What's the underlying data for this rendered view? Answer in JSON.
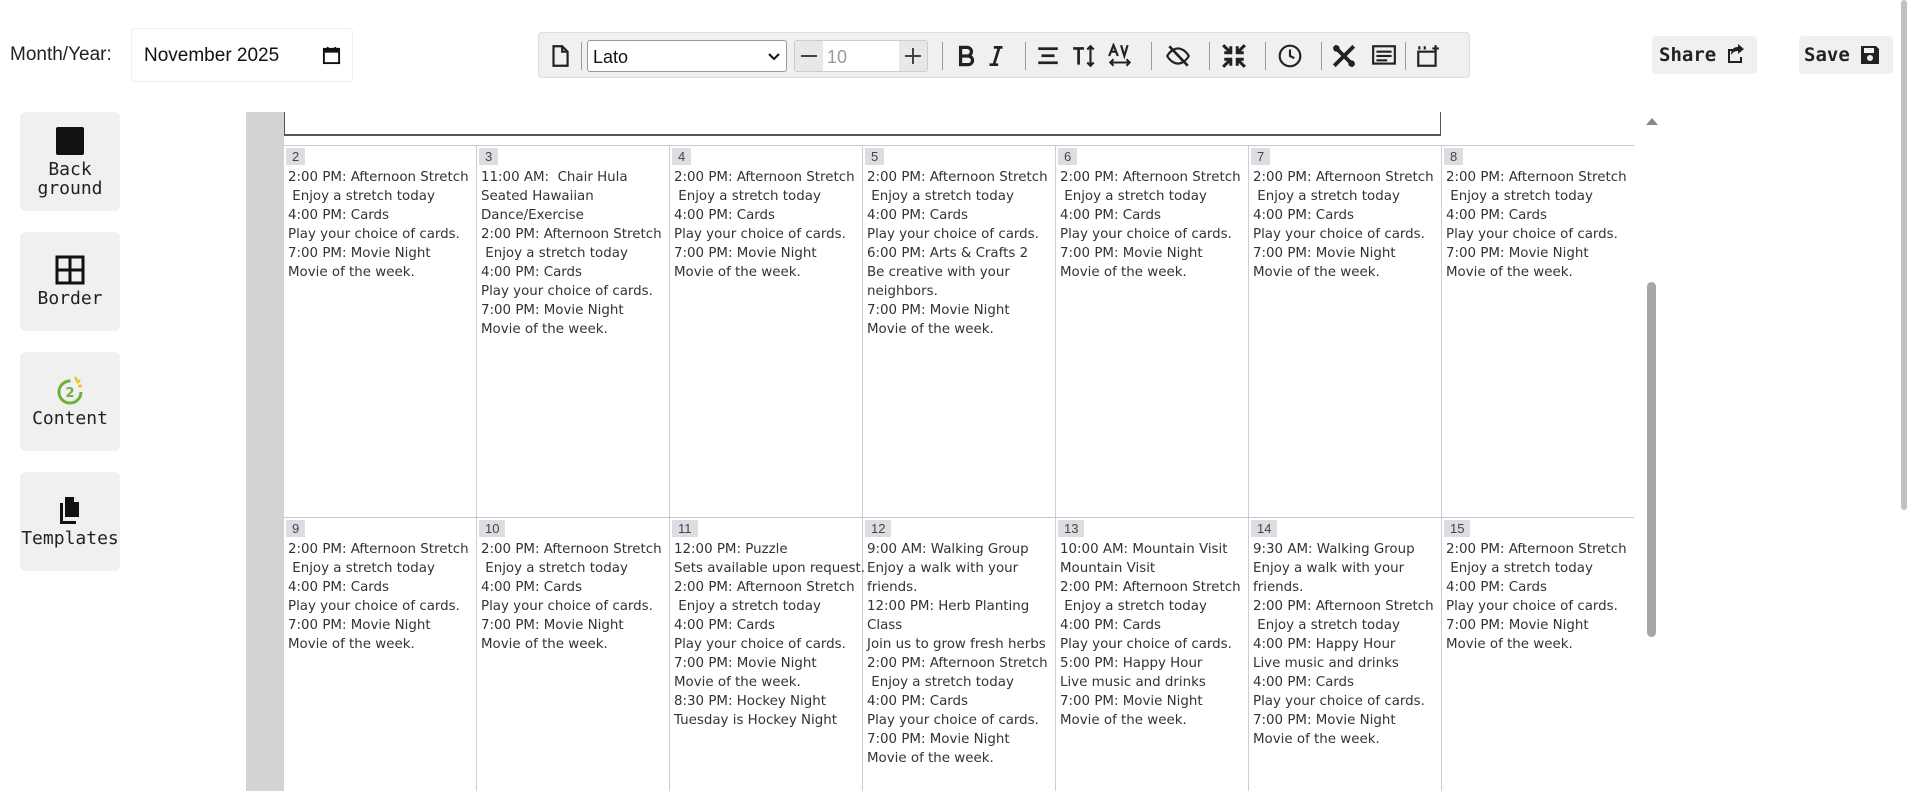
{
  "header": {
    "month_year_label": "Month/Year:",
    "month_year_value": "November 2025"
  },
  "toolbar": {
    "font_family": "Lato",
    "font_size_placeholder": "10"
  },
  "actions": {
    "share_label": "Share",
    "save_label": "Save"
  },
  "sidebar": {
    "background_label": "Back\nground",
    "border_label": "Border",
    "content_label": "Content",
    "content_badge": "2",
    "templates_label": "Templates"
  },
  "calendar": {
    "weeks": [
      {
        "days": [
          {
            "day": "2",
            "events": [
              "2:00 PM: Afternoon Stretch",
              " Enjoy a stretch today",
              "4:00 PM: Cards",
              "Play your choice of cards.",
              "7:00 PM: Movie Night",
              "Movie of the week."
            ]
          },
          {
            "day": "3",
            "events": [
              "11:00 AM:  Chair Hula",
              "Seated Hawaiian",
              "Dance/Exercise",
              "2:00 PM: Afternoon Stretch",
              " Enjoy a stretch today",
              "4:00 PM: Cards",
              "Play your choice of cards.",
              "7:00 PM: Movie Night",
              "Movie of the week."
            ]
          },
          {
            "day": "4",
            "events": [
              "2:00 PM: Afternoon Stretch",
              " Enjoy a stretch today",
              "4:00 PM: Cards",
              "Play your choice of cards.",
              "7:00 PM: Movie Night",
              "Movie of the week."
            ]
          },
          {
            "day": "5",
            "events": [
              "2:00 PM: Afternoon Stretch",
              " Enjoy a stretch today",
              "4:00 PM: Cards",
              "Play your choice of cards.",
              "6:00 PM: Arts & Crafts 2",
              "Be creative with your",
              "neighbors.",
              "7:00 PM: Movie Night",
              "Movie of the week."
            ]
          },
          {
            "day": "6",
            "events": [
              "2:00 PM: Afternoon Stretch",
              " Enjoy a stretch today",
              "4:00 PM: Cards",
              "Play your choice of cards.",
              "7:00 PM: Movie Night",
              "Movie of the week."
            ]
          },
          {
            "day": "7",
            "events": [
              "2:00 PM: Afternoon Stretch",
              " Enjoy a stretch today",
              "4:00 PM: Cards",
              "Play your choice of cards.",
              "7:00 PM: Movie Night",
              "Movie of the week."
            ]
          },
          {
            "day": "8",
            "events": [
              "2:00 PM: Afternoon Stretch",
              " Enjoy a stretch today",
              "4:00 PM: Cards",
              "Play your choice of cards.",
              "7:00 PM: Movie Night",
              "Movie of the week."
            ]
          }
        ]
      },
      {
        "days": [
          {
            "day": "9",
            "events": [
              "2:00 PM: Afternoon Stretch",
              " Enjoy a stretch today",
              "4:00 PM: Cards",
              "Play your choice of cards.",
              "7:00 PM: Movie Night",
              "Movie of the week."
            ]
          },
          {
            "day": "10",
            "events": [
              "2:00 PM: Afternoon Stretch",
              " Enjoy a stretch today",
              "4:00 PM: Cards",
              "Play your choice of cards.",
              "7:00 PM: Movie Night",
              "Movie of the week."
            ]
          },
          {
            "day": "11",
            "events": [
              "12:00 PM: Puzzle",
              "Sets available upon request.",
              "2:00 PM: Afternoon Stretch",
              " Enjoy a stretch today",
              "4:00 PM: Cards",
              "Play your choice of cards.",
              "7:00 PM: Movie Night",
              "Movie of the week.",
              "8:30 PM: Hockey Night",
              "Tuesday is Hockey Night"
            ]
          },
          {
            "day": "12",
            "events": [
              "9:00 AM: Walking Group",
              "Enjoy a walk with your",
              "friends.",
              "12:00 PM: Herb Planting",
              "Class",
              "Join us to grow fresh herbs",
              "2:00 PM: Afternoon Stretch",
              " Enjoy a stretch today",
              "4:00 PM: Cards",
              "Play your choice of cards.",
              "7:00 PM: Movie Night",
              "Movie of the week."
            ]
          },
          {
            "day": "13",
            "events": [
              "10:00 AM: Mountain Visit",
              "Mountain Visit",
              "2:00 PM: Afternoon Stretch",
              " Enjoy a stretch today",
              "4:00 PM: Cards",
              "Play your choice of cards.",
              "5:00 PM: Happy Hour",
              "Live music and drinks",
              "7:00 PM: Movie Night",
              "Movie of the week."
            ]
          },
          {
            "day": "14",
            "events": [
              "9:30 AM: Walking Group",
              "Enjoy a walk with your",
              "friends.",
              "2:00 PM: Afternoon Stretch",
              " Enjoy a stretch today",
              "4:00 PM: Happy Hour",
              "Live music and drinks",
              "4:00 PM: Cards",
              "Play your choice of cards.",
              "7:00 PM: Movie Night",
              "Movie of the week."
            ]
          },
          {
            "day": "15",
            "events": [
              "2:00 PM: Afternoon Stretch",
              " Enjoy a stretch today",
              "4:00 PM: Cards",
              "Play your choice of cards.",
              "7:00 PM: Movie Night",
              "Movie of the week."
            ]
          }
        ]
      }
    ]
  },
  "colors": {
    "panel_bg": "#f0f0f0",
    "gutter": "#d3d3d3",
    "day_number_bg": "#dcdde3",
    "content_icon_green": "#6ab23a",
    "content_icon_yellow": "#f0c21c"
  }
}
